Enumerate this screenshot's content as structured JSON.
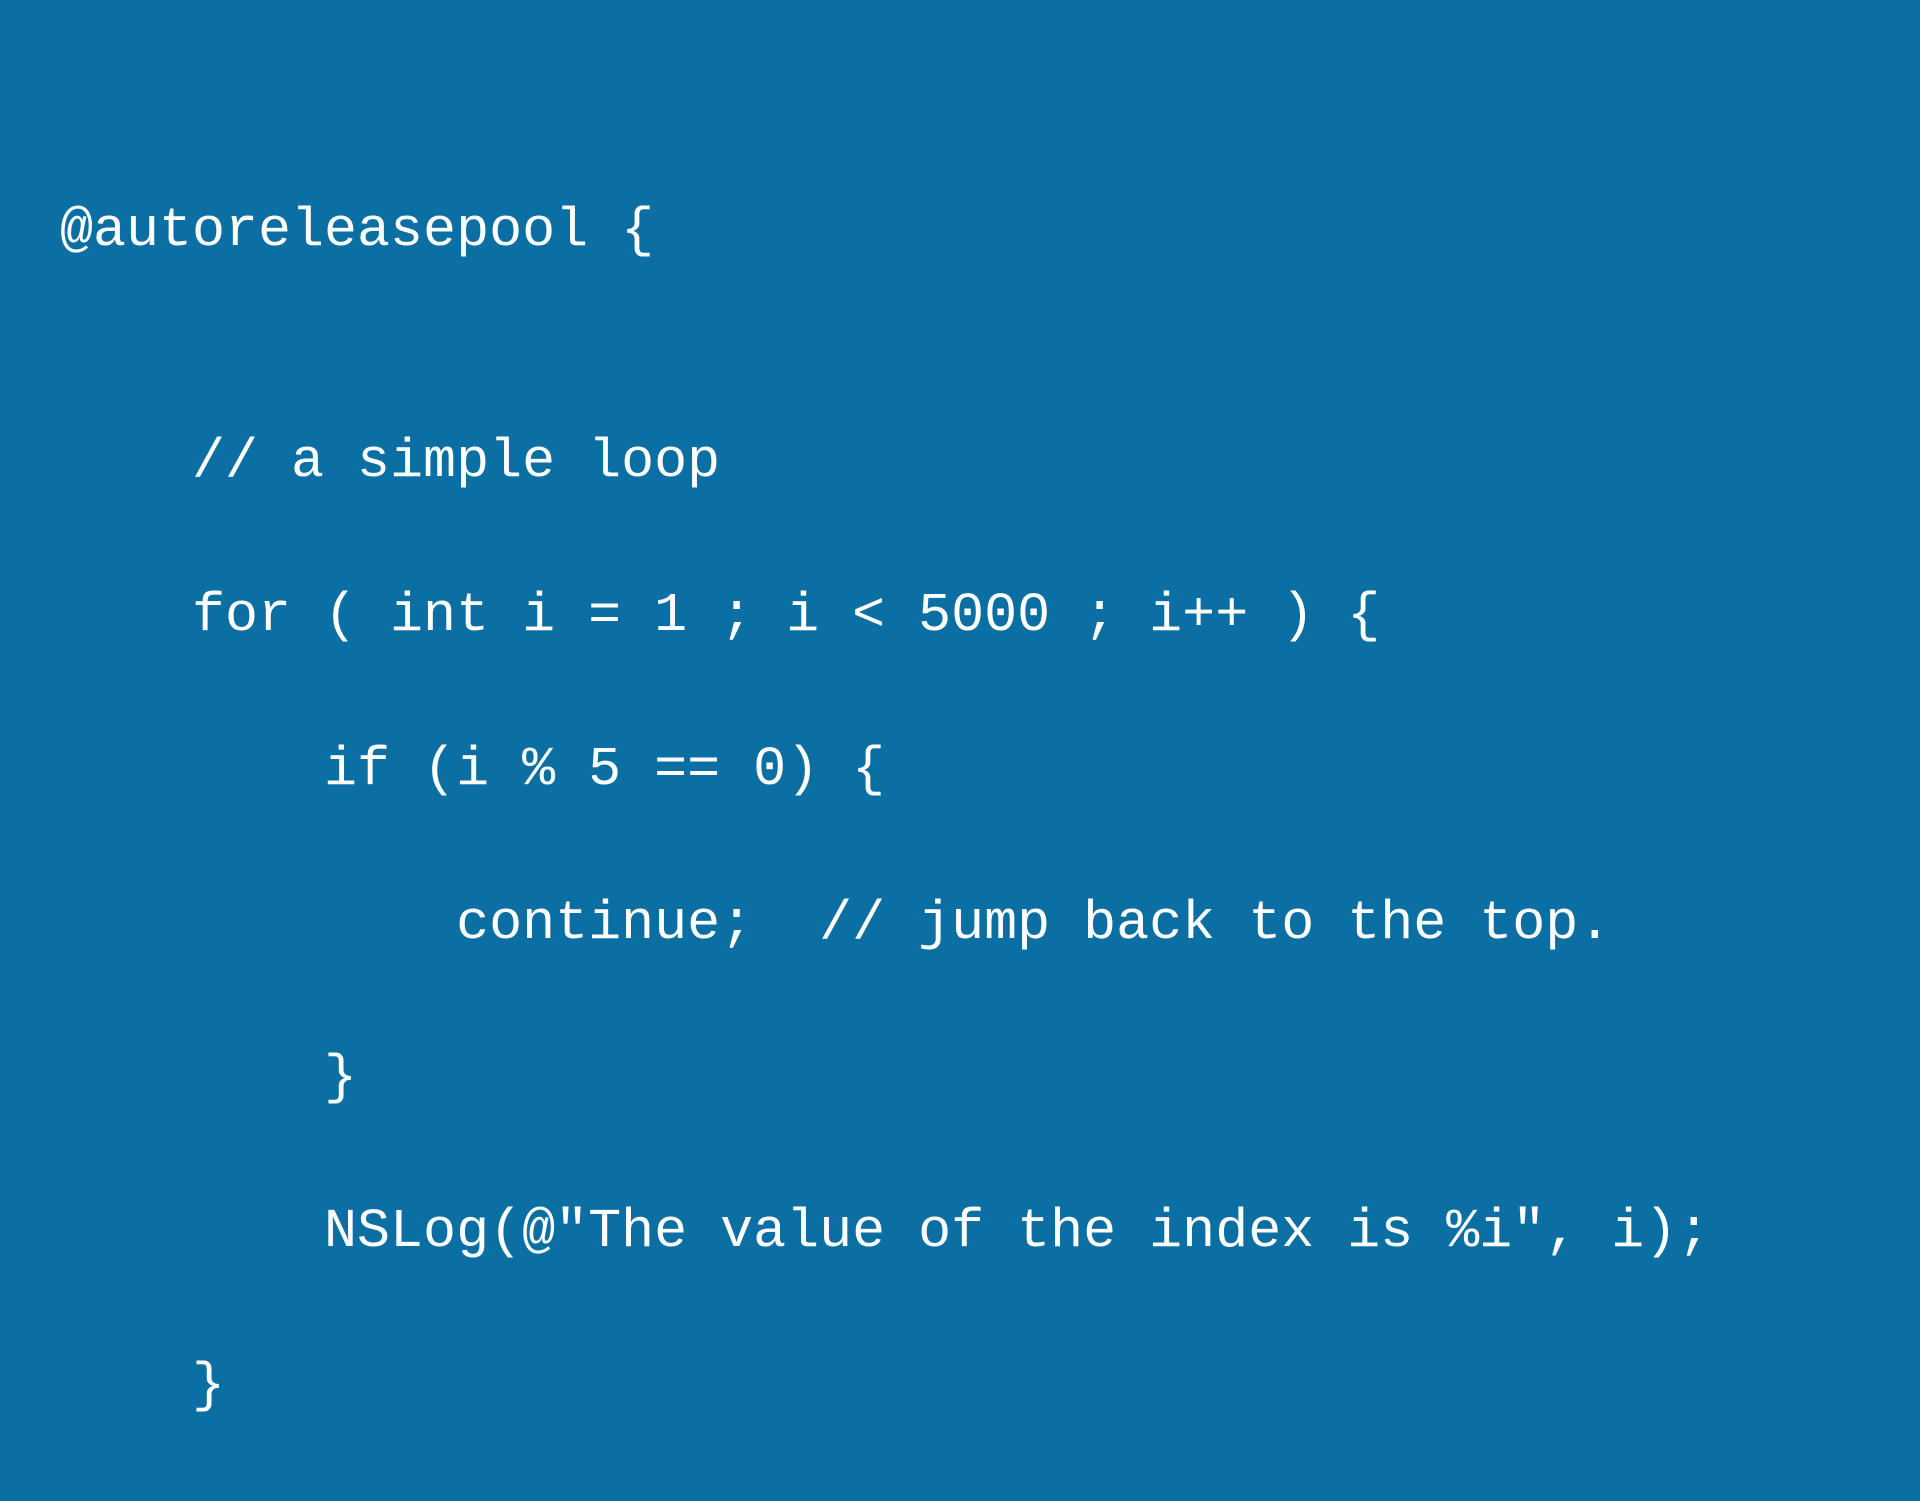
{
  "code": {
    "line1": "@autoreleasepool {",
    "line2": "",
    "line3": "    // a simple loop",
    "line4": "    for ( int i = 1 ; i < 5000 ; i++ ) {",
    "line5": "        if (i % 5 == 0) {",
    "line6": "            continue;  // jump back to the top.",
    "line7": "        }",
    "line8": "        NSLog(@\"The value of the index is %i\", i);",
    "line9": "    }"
  }
}
